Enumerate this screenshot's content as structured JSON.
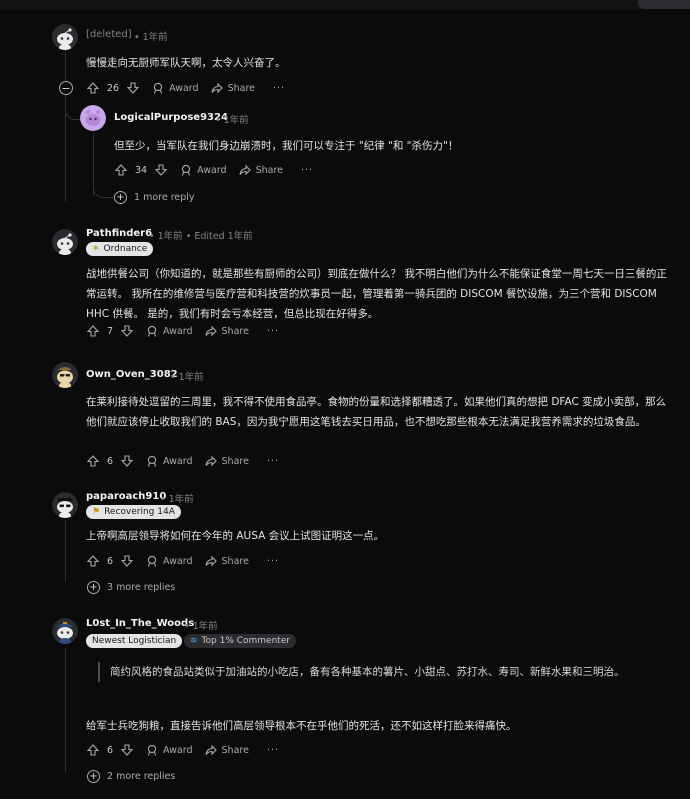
{
  "comments": [
    {
      "user": "[deleted]",
      "time": "1年前",
      "body": "慢慢走向无厨师军队天啊，太令人兴奋了。",
      "votes": "26",
      "award": "Award",
      "share": "Share"
    },
    {
      "user": "LogicalPurpose9324",
      "time": "1年前",
      "body": "但至少，当军队在我们身边崩溃时，我们可以专注于 \"纪律 \"和 \"杀伤力\"！",
      "votes": "34",
      "award": "Award",
      "share": "Share",
      "more": "1 more reply"
    },
    {
      "user": "Pathfinder6",
      "time": "1年前",
      "edited": "Edited 1年前",
      "flair": "Ordnance",
      "body": "战地供餐公司（你知道的，就是那些有厨师的公司）到底在做什么？ 我不明白他们为什么不能保证食堂一周七天一日三餐的正常运转。 我所在的维修营与医疗营和科技营的炊事员一起，管理着第一骑兵团的 DISCOM 餐饮设施，为三个营和 DISCOM HHC 供餐。 是的，我们有时会亏本经营，但总比现在好得多。",
      "votes": "7",
      "award": "Award",
      "share": "Share"
    },
    {
      "user": "Own_Oven_3082",
      "time": "1年前",
      "body": "在莱利接待处逗留的三周里，我不得不使用食品亭。食物的份量和选择都糟透了。如果他们真的想把 DFAC 变成小卖部，那么他们就应该停止收取我们的 BAS，因为我宁愿用这笔钱去买日用品，也不想吃那些根本无法满足我营养需求的垃圾食品。",
      "votes": "6",
      "award": "Award",
      "share": "Share"
    },
    {
      "user": "paparoach910",
      "time": "1年前",
      "flair": "Recovering 14A",
      "body": "上帝啊高层领导将如何在今年的 AUSA 会议上试图证明这一点。",
      "votes": "6",
      "award": "Award",
      "share": "Share",
      "more": "3 more replies"
    },
    {
      "user": "L0st_In_The_Woods",
      "time": "1年前",
      "flair": "Newest Logistician",
      "flair2": "Top 1% Commenter",
      "quote": "简约风格的食品站类似于加油站的小吃店，备有各种基本的薯片、小甜点、苏打水、寿司、新鲜水果和三明治。",
      "body": "给军士兵吃狗粮，直接告诉他们高层领导根本不在乎他们的死活，还不如这样打脸来得痛快。",
      "votes": "6",
      "award": "Award",
      "share": "Share",
      "more": "2 more replies"
    }
  ],
  "colors": {
    "background": "#0b0b0c",
    "text": "#e3e4e6",
    "muted": "#818384",
    "thread_line": "#2c2f33"
  },
  "icons": [
    "snoo-avatar-icon",
    "upvote-icon",
    "downvote-icon",
    "award-icon",
    "share-icon",
    "more-options-icon",
    "collapse-icon",
    "expand-plus-icon"
  ]
}
